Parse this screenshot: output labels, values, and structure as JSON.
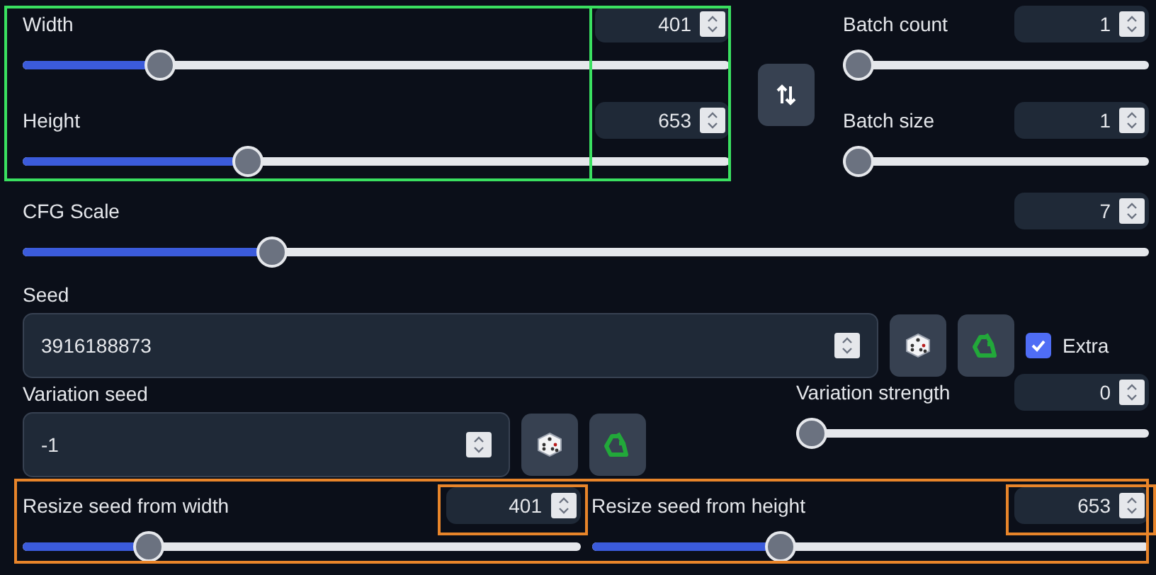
{
  "size": {
    "highlight": {
      "color": "#3ae060"
    },
    "sliders": [
      {
        "label": "Width",
        "value": "401",
        "level": 0.18
      },
      {
        "label": "Height",
        "value": "653",
        "level": 0.31
      }
    ]
  },
  "batch": {
    "sliders": [
      {
        "label": "Batch count",
        "value": "1",
        "level": 0
      },
      {
        "label": "Batch size",
        "value": "1",
        "level": 0
      }
    ]
  },
  "cfg": {
    "label": "CFG Scale",
    "value": "7",
    "level": 0.214
  },
  "seed": {
    "label": "Seed",
    "value": "3916188873",
    "extra": {
      "label": "Extra",
      "checked": true
    }
  },
  "variation_seed": {
    "label": "Variation seed",
    "value": "-1"
  },
  "variation_strength": {
    "label": "Variation strength",
    "value": "0",
    "level": 0
  },
  "resize": {
    "highlight": {
      "color": "#e8852a"
    },
    "sliders": [
      {
        "label": "Resize seed from width",
        "value": "401",
        "level": 0.21
      },
      {
        "label": "Resize seed from height",
        "value": "653",
        "level": 0.33
      }
    ]
  }
}
